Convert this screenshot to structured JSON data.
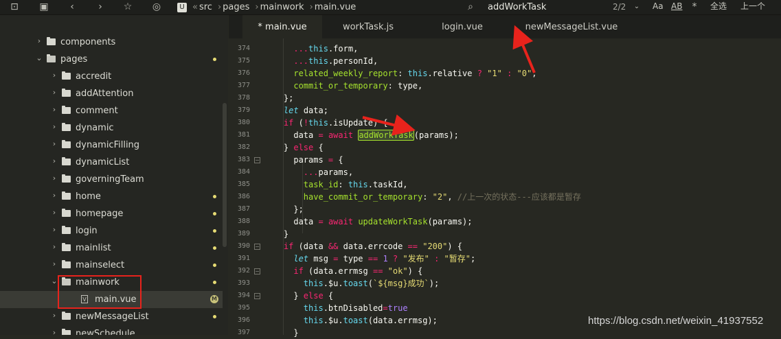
{
  "breadcrumb": [
    "src",
    "pages",
    "mainwork",
    "main.vue"
  ],
  "search": {
    "query": "addWorkTask",
    "count": "2/2"
  },
  "toolbar": {
    "aa_label": "Aa",
    "ab_label": "AB",
    "select_all_label": "全选",
    "prev_label": "上一个"
  },
  "sidebar": {
    "items": [
      {
        "label": "components",
        "type": "folder",
        "expanded": false,
        "indent": 0,
        "dot": false
      },
      {
        "label": "pages",
        "type": "folder",
        "expanded": true,
        "indent": 0,
        "dot": true
      },
      {
        "label": "accredit",
        "type": "folder",
        "expanded": false,
        "indent": 1,
        "dot": false
      },
      {
        "label": "addAttention",
        "type": "folder",
        "expanded": false,
        "indent": 1,
        "dot": false
      },
      {
        "label": "comment",
        "type": "folder",
        "expanded": false,
        "indent": 1,
        "dot": false
      },
      {
        "label": "dynamic",
        "type": "folder",
        "expanded": false,
        "indent": 1,
        "dot": false
      },
      {
        "label": "dynamicFilling",
        "type": "folder",
        "expanded": false,
        "indent": 1,
        "dot": false
      },
      {
        "label": "dynamicList",
        "type": "folder",
        "expanded": false,
        "indent": 1,
        "dot": false
      },
      {
        "label": "governingTeam",
        "type": "folder",
        "expanded": false,
        "indent": 1,
        "dot": false
      },
      {
        "label": "home",
        "type": "folder",
        "expanded": false,
        "indent": 1,
        "dot": true
      },
      {
        "label": "homepage",
        "type": "folder",
        "expanded": false,
        "indent": 1,
        "dot": true
      },
      {
        "label": "login",
        "type": "folder",
        "expanded": false,
        "indent": 1,
        "dot": true
      },
      {
        "label": "mainlist",
        "type": "folder",
        "expanded": false,
        "indent": 1,
        "dot": true
      },
      {
        "label": "mainselect",
        "type": "folder",
        "expanded": false,
        "indent": 1,
        "dot": true
      },
      {
        "label": "mainwork",
        "type": "folder",
        "expanded": true,
        "indent": 1,
        "dot": true
      },
      {
        "label": "main.vue",
        "type": "file",
        "indent": 2,
        "badge": "M",
        "active": true
      },
      {
        "label": "newMessageList",
        "type": "folder",
        "expanded": false,
        "indent": 1,
        "dot": true
      },
      {
        "label": "newSchedule",
        "type": "folder",
        "expanded": false,
        "indent": 1,
        "dot": false
      }
    ]
  },
  "tabs": [
    {
      "label": "* main.vue",
      "active": true
    },
    {
      "label": "workTask.js",
      "active": false
    },
    {
      "label": "login.vue",
      "active": false
    },
    {
      "label": "newMessageList.vue",
      "active": false
    }
  ],
  "code": {
    "lines": [
      {
        "n": "374",
        "fold": false,
        "tokens": [
          [
            "      ",
            ""
          ],
          [
            "...",
            "k"
          ],
          [
            "this",
            "t"
          ],
          [
            ".form,",
            ""
          ]
        ]
      },
      {
        "n": "375",
        "fold": false,
        "tokens": [
          [
            "      ",
            ""
          ],
          [
            "...",
            "k"
          ],
          [
            "this",
            "t"
          ],
          [
            ".personId,",
            ""
          ]
        ]
      },
      {
        "n": "376",
        "fold": false,
        "tokens": [
          [
            "      ",
            ""
          ],
          [
            "related_weekly_report",
            "p"
          ],
          [
            ": ",
            ""
          ],
          [
            "this",
            "t"
          ],
          [
            ".relative ",
            ""
          ],
          [
            "?",
            "k"
          ],
          [
            " ",
            ""
          ],
          [
            "\"1\"",
            "s"
          ],
          [
            " ",
            ""
          ],
          [
            ":",
            "k"
          ],
          [
            " ",
            ""
          ],
          [
            "\"0\"",
            "s"
          ],
          [
            ",",
            ""
          ]
        ]
      },
      {
        "n": "377",
        "fold": false,
        "tokens": [
          [
            "      ",
            ""
          ],
          [
            "commit_or_temporary",
            "p"
          ],
          [
            ": type,",
            ""
          ]
        ]
      },
      {
        "n": "378",
        "fold": false,
        "tokens": [
          [
            "    };",
            ""
          ]
        ]
      },
      {
        "n": "379",
        "fold": false,
        "tokens": [
          [
            "    ",
            ""
          ],
          [
            "let",
            "kw"
          ],
          [
            " data;",
            ""
          ]
        ]
      },
      {
        "n": "380",
        "fold": false,
        "tokens": [
          [
            "    ",
            ""
          ],
          [
            "if",
            "k"
          ],
          [
            " (",
            ""
          ],
          [
            "!",
            "k"
          ],
          [
            "this",
            "t"
          ],
          [
            ".isUpdate) {",
            ""
          ]
        ]
      },
      {
        "n": "381",
        "fold": false,
        "tokens": [
          [
            "      data ",
            ""
          ],
          [
            "=",
            "k"
          ],
          [
            " ",
            ""
          ],
          [
            "await",
            "k"
          ],
          [
            " ",
            ""
          ],
          [
            "addWorkTask",
            "p hl"
          ],
          [
            "(params);",
            ""
          ]
        ]
      },
      {
        "n": "382",
        "fold": false,
        "tokens": [
          [
            "    } ",
            ""
          ],
          [
            "else",
            "k"
          ],
          [
            " {",
            ""
          ]
        ]
      },
      {
        "n": "383",
        "fold": true,
        "tokens": [
          [
            "      params ",
            ""
          ],
          [
            "=",
            "k"
          ],
          [
            " {",
            ""
          ]
        ]
      },
      {
        "n": "384",
        "fold": false,
        "tokens": [
          [
            "        ",
            ""
          ],
          [
            "...",
            "k"
          ],
          [
            "params,",
            ""
          ]
        ]
      },
      {
        "n": "385",
        "fold": false,
        "tokens": [
          [
            "        ",
            ""
          ],
          [
            "task_id",
            "p"
          ],
          [
            ": ",
            ""
          ],
          [
            "this",
            "t"
          ],
          [
            ".taskId,",
            ""
          ]
        ]
      },
      {
        "n": "386",
        "fold": false,
        "tokens": [
          [
            "        ",
            ""
          ],
          [
            "have_commit_or_temporary",
            "p"
          ],
          [
            ": ",
            ""
          ],
          [
            "\"2\"",
            "s"
          ],
          [
            ", ",
            ""
          ],
          [
            "//上一次的状态---应该都是暂存",
            "c"
          ]
        ]
      },
      {
        "n": "387",
        "fold": false,
        "tokens": [
          [
            "      };",
            ""
          ]
        ]
      },
      {
        "n": "388",
        "fold": false,
        "tokens": [
          [
            "      data ",
            ""
          ],
          [
            "=",
            "k"
          ],
          [
            " ",
            ""
          ],
          [
            "await",
            "k"
          ],
          [
            " ",
            ""
          ],
          [
            "updateWorkTask",
            "p"
          ],
          [
            "(params);",
            ""
          ]
        ]
      },
      {
        "n": "389",
        "fold": false,
        "tokens": [
          [
            "    }",
            ""
          ]
        ]
      },
      {
        "n": "390",
        "fold": true,
        "tokens": [
          [
            "    ",
            ""
          ],
          [
            "if",
            "k"
          ],
          [
            " (data ",
            ""
          ],
          [
            "&&",
            "k"
          ],
          [
            " data.errcode ",
            ""
          ],
          [
            "==",
            "k"
          ],
          [
            " ",
            ""
          ],
          [
            "\"200\"",
            "s"
          ],
          [
            ") {",
            ""
          ]
        ]
      },
      {
        "n": "391",
        "fold": false,
        "tokens": [
          [
            "      ",
            ""
          ],
          [
            "let",
            "kw"
          ],
          [
            " msg ",
            ""
          ],
          [
            "=",
            "k"
          ],
          [
            " type ",
            ""
          ],
          [
            "==",
            "k"
          ],
          [
            " ",
            ""
          ],
          [
            "1",
            "n"
          ],
          [
            " ",
            ""
          ],
          [
            "?",
            "k"
          ],
          [
            " ",
            ""
          ],
          [
            "\"发布\"",
            "s"
          ],
          [
            " ",
            ""
          ],
          [
            ":",
            "k"
          ],
          [
            " ",
            ""
          ],
          [
            "\"暂存\"",
            "s"
          ],
          [
            ";",
            ""
          ]
        ]
      },
      {
        "n": "392",
        "fold": true,
        "tokens": [
          [
            "      ",
            ""
          ],
          [
            "if",
            "k"
          ],
          [
            " (data.errmsg ",
            ""
          ],
          [
            "==",
            "k"
          ],
          [
            " ",
            ""
          ],
          [
            "\"ok\"",
            "s"
          ],
          [
            ") {",
            ""
          ]
        ]
      },
      {
        "n": "393",
        "fold": false,
        "tokens": [
          [
            "        ",
            ""
          ],
          [
            "this",
            "t"
          ],
          [
            ".$u.",
            ""
          ],
          [
            "toast",
            "t"
          ],
          [
            "(",
            ""
          ],
          [
            "`${msg}成功`",
            "s"
          ],
          [
            ");",
            ""
          ]
        ]
      },
      {
        "n": "394",
        "fold": true,
        "tokens": [
          [
            "      } ",
            ""
          ],
          [
            "else",
            "k"
          ],
          [
            " {",
            ""
          ]
        ]
      },
      {
        "n": "395",
        "fold": false,
        "tokens": [
          [
            "        ",
            ""
          ],
          [
            "this",
            "t"
          ],
          [
            ".btnDisabled",
            ""
          ],
          [
            "=",
            "k"
          ],
          [
            "true",
            "n"
          ]
        ]
      },
      {
        "n": "396",
        "fold": false,
        "tokens": [
          [
            "        ",
            ""
          ],
          [
            "this",
            "t"
          ],
          [
            ".$u.",
            ""
          ],
          [
            "toast",
            "t"
          ],
          [
            "(data.errmsg);",
            ""
          ]
        ]
      },
      {
        "n": "397",
        "fold": false,
        "tokens": [
          [
            "      }",
            ""
          ]
        ]
      }
    ]
  },
  "watermark": "https://blog.csdn.net/weixin_41937552",
  "colors": {
    "highlight_box": "#e8231c",
    "keyword": "#f92672",
    "string": "#e6db74",
    "property": "#a6e22e",
    "builtin": "#66d9ef"
  }
}
